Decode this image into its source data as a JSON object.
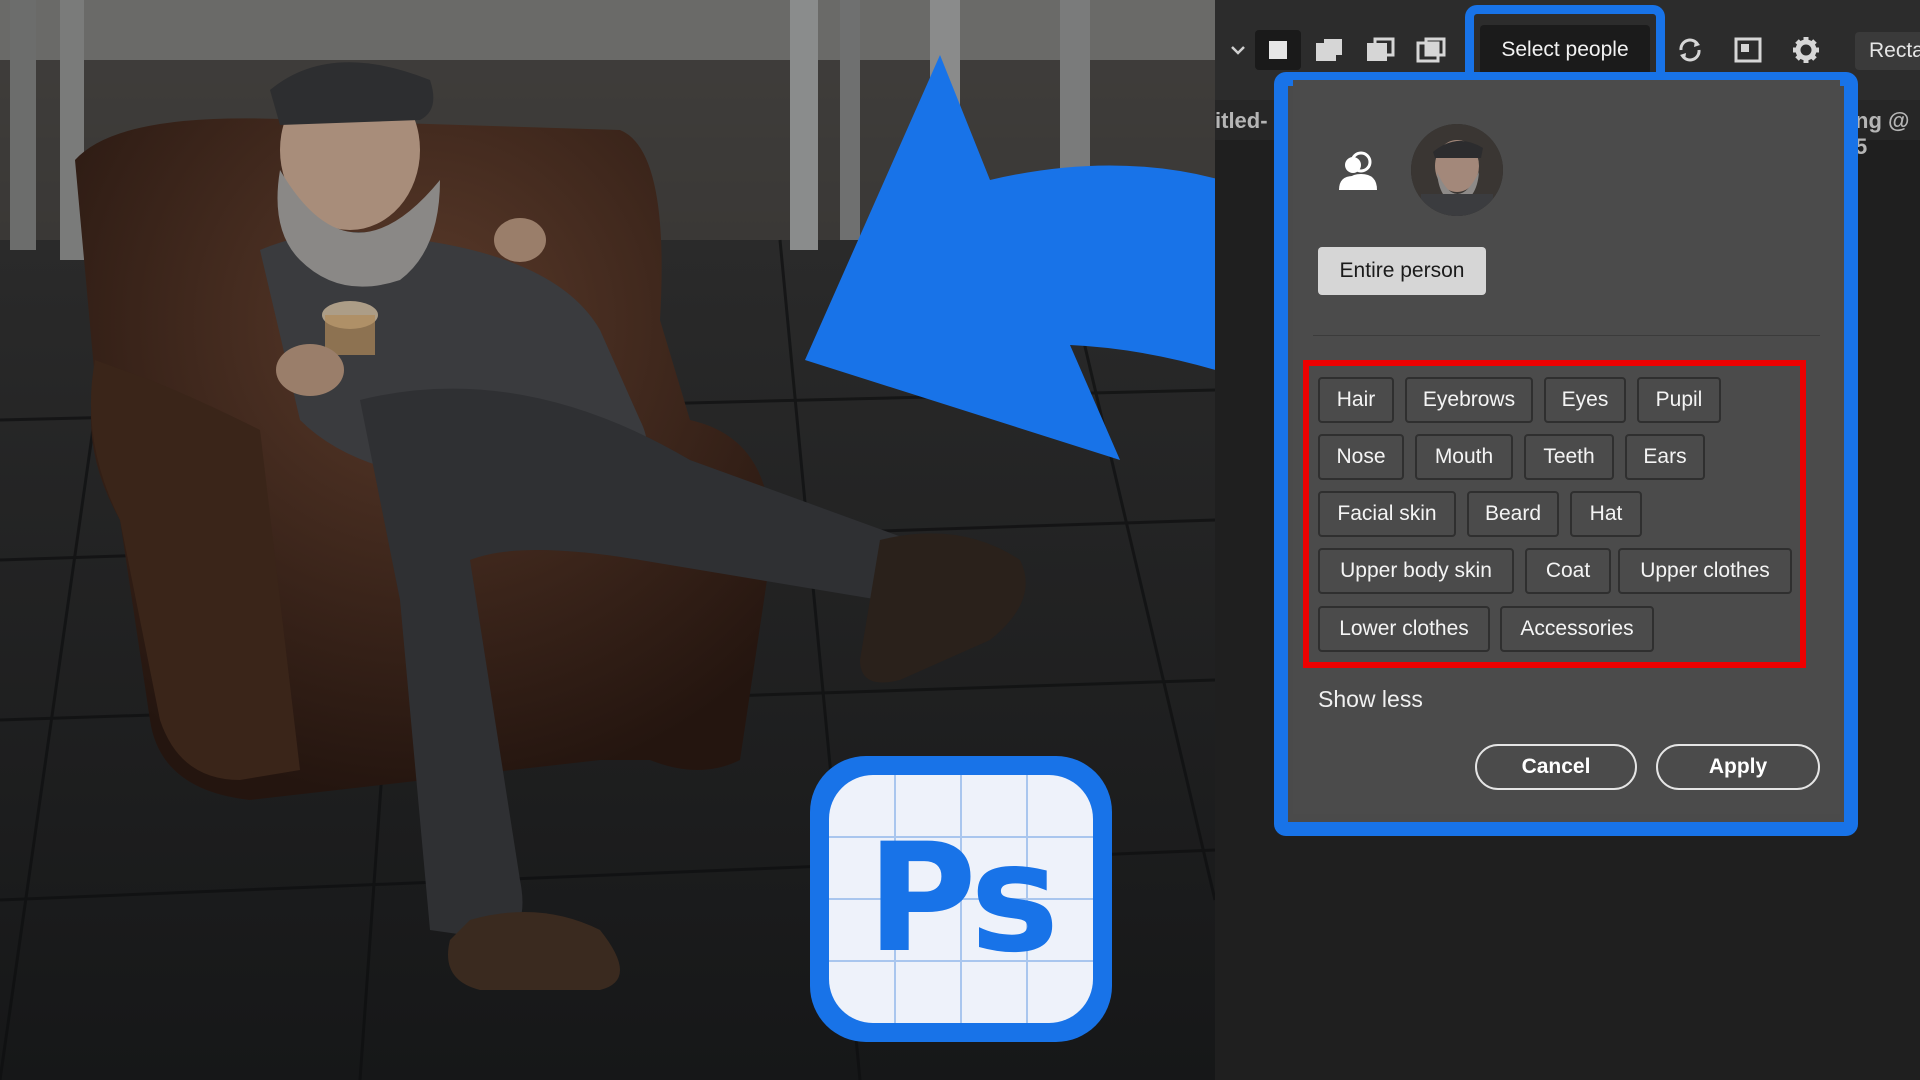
{
  "toolbar": {
    "select_people_label": "Select people",
    "rect_label": "Recta",
    "icons": [
      "chevron-down-icon",
      "new-selection-icon",
      "add-selection-icon",
      "subtract-selection-icon",
      "intersect-selection-icon",
      "refresh-icon",
      "select-subject-icon",
      "gear-icon"
    ]
  },
  "tabs": {
    "left_tab": "itled-",
    "right_tab": "ng @ 5"
  },
  "panel": {
    "entire_person_label": "Entire person",
    "chips": [
      "Hair",
      "Eyebrows",
      "Eyes",
      "Pupil",
      "Nose",
      "Mouth",
      "Teeth",
      "Ears",
      "Facial skin",
      "Beard",
      "Hat",
      "Upper body skin",
      "Coat",
      "Upper clothes",
      "Lower clothes",
      "Accessories"
    ],
    "show_less_label": "Show less",
    "cancel_label": "Cancel",
    "apply_label": "Apply"
  },
  "logo": {
    "text": "Ps"
  },
  "colors": {
    "accent_blue": "#1873e8",
    "highlight_red": "#ee0000",
    "panel_bg": "#4b4b4b"
  }
}
